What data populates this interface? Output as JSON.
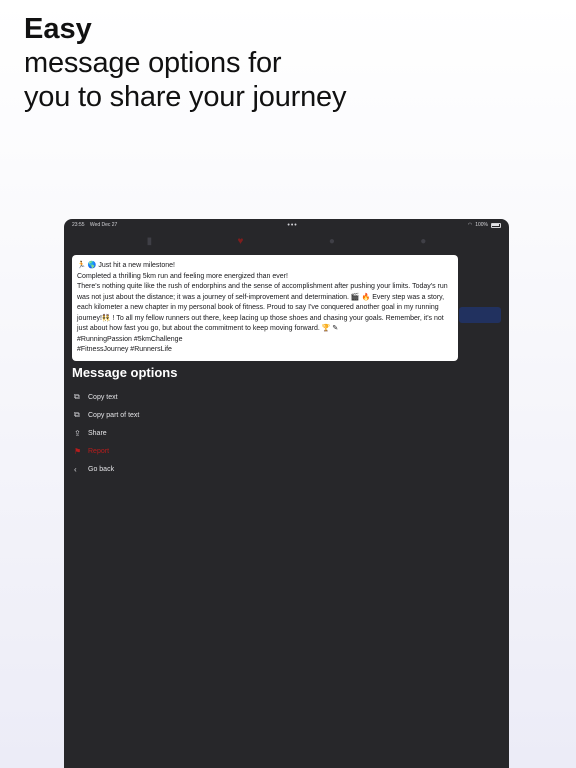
{
  "headline": {
    "bold": "Easy",
    "line1": "message options for",
    "line2": "you to share your journey"
  },
  "status_bar": {
    "time": "23:55",
    "date": "Wed Dec 27",
    "dots": "•••",
    "battery": "100%"
  },
  "tab_bar": {
    "icons": [
      "trash-icon",
      "heart-icon",
      "circle-icon",
      "circle-icon"
    ]
  },
  "message": {
    "text": "🏃 🌎 Just hit a new milestone!\nCompleted a thrilling 5km run and feeling more energized than ever!\nThere's nothing quite like the rush of endorphins and the sense of accomplishment after pushing your limits. Today's run was not just about the distance; it was a journey of self-improvement and determination. 🎬 🔥 Every step was a story, each kilometer a new chapter in my personal book of fitness. Proud to say I've conquered another goal in my running journey!👯 ! To all my fellow runners out there, keep lacing up those shoes and chasing your goals. Remember, it's not just about how fast you go, but about the commitment to keep moving forward. 🏆 ✎\n#RunningPassion #5kmChallenge\n#FitnessJourney #RunnersLife"
  },
  "options": {
    "title": "Message options",
    "items": [
      {
        "label": "Copy text",
        "icon": "copy-icon"
      },
      {
        "label": "Copy part of text",
        "icon": "copy-part-icon"
      },
      {
        "label": "Share",
        "icon": "share-icon"
      },
      {
        "label": "Report",
        "icon": "flag-icon"
      },
      {
        "label": "Go back",
        "icon": "chevron-left-icon"
      }
    ]
  },
  "colors": {
    "device_bg": "#27272a",
    "danger": "#b91c1c",
    "bubble_bg": "#ffffff"
  }
}
